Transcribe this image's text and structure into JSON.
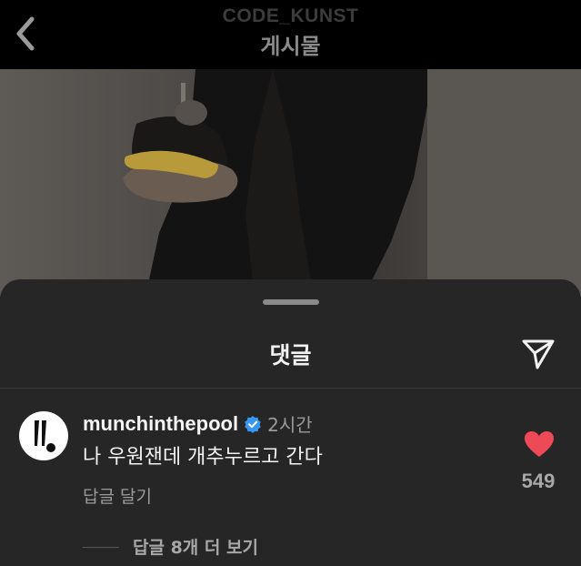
{
  "header": {
    "account_name": "CODE_KUNST",
    "title": "게시물",
    "back_icon": "chevron-left-icon"
  },
  "sheet": {
    "title": "댓글",
    "share_icon": "paper-plane-icon"
  },
  "comment": {
    "username": "munchinthepool",
    "verified_icon": "verified-badge-icon",
    "time": "2시간",
    "text": "나 우원잰데 개추누르고 간다",
    "reply_label": "답글 달기",
    "like_icon": "heart-icon",
    "like_count": "549",
    "liked": true,
    "more_replies_label": "답글 8개 더 보기"
  },
  "colors": {
    "sheet_bg": "#262626",
    "heart": "#ed4956",
    "verified": "#3897f0"
  }
}
